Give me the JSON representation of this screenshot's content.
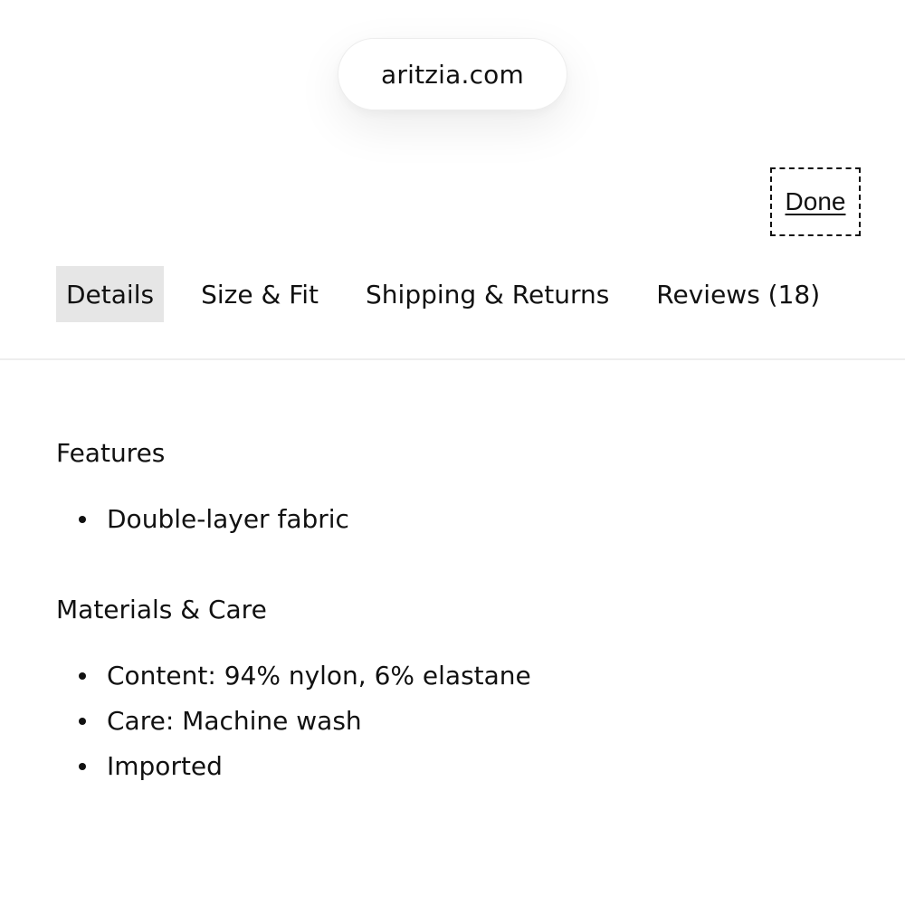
{
  "browser": {
    "url": "aritzia.com"
  },
  "header": {
    "done_label": "Done"
  },
  "tabs": [
    {
      "label": "Details",
      "active": true
    },
    {
      "label": "Size & Fit",
      "active": false
    },
    {
      "label": "Shipping & Returns",
      "active": false
    },
    {
      "label": "Reviews (18)",
      "active": false
    }
  ],
  "sections": {
    "features": {
      "title": "Features",
      "items": [
        "Double-layer fabric"
      ]
    },
    "materials": {
      "title": "Materials & Care",
      "items": [
        "Content: 94% nylon, 6% elastane",
        "Care: Machine wash",
        "Imported"
      ]
    }
  },
  "colors": {
    "active_tab_bg": "#e6e6e6",
    "text": "#111111",
    "divider": "#eeeeee"
  }
}
